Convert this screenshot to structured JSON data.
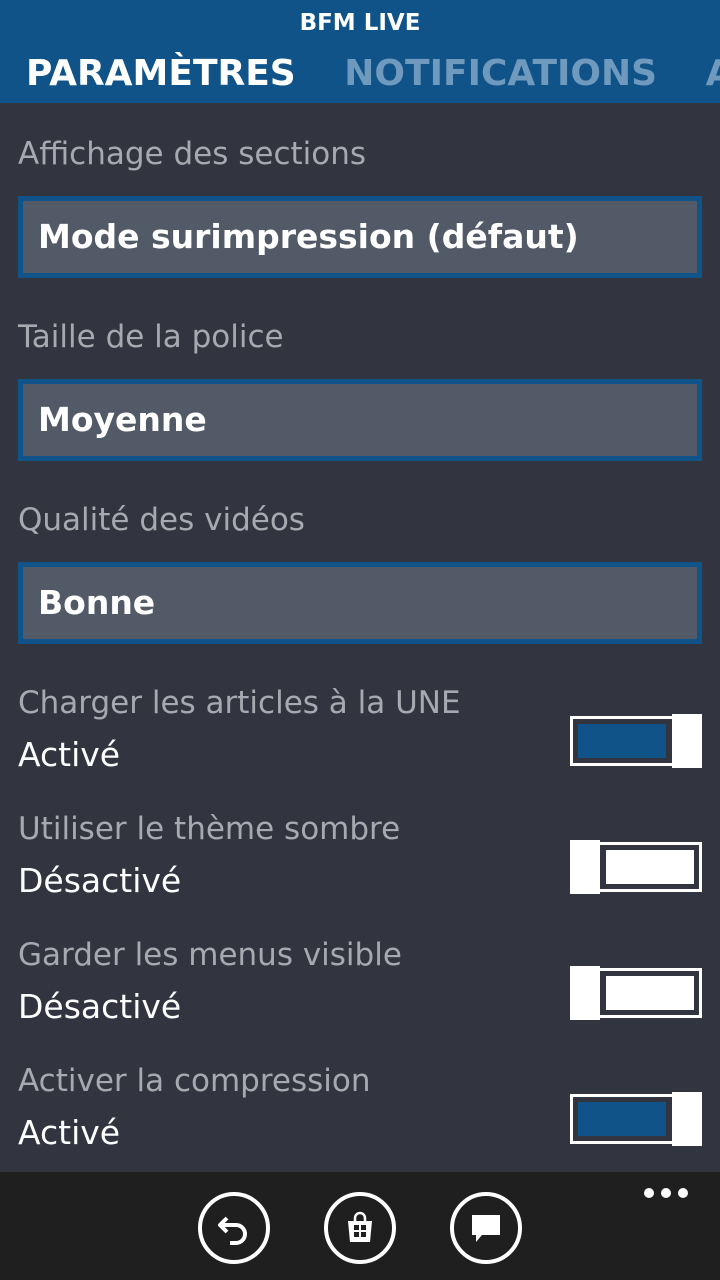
{
  "header": {
    "app_title": "BFM LIVE",
    "pivots": [
      "PARAMÈTRES",
      "NOTIFICATIONS",
      "A PROPOS"
    ]
  },
  "sections": {
    "label": "Affichage des sections",
    "value": "Mode surimpression (défaut)"
  },
  "font_size": {
    "label": "Taille de la police",
    "value": "Moyenne"
  },
  "video_quality": {
    "label": "Qualité des vidéos",
    "value": "Bonne"
  },
  "toggles": [
    {
      "title": "Charger les articles à la UNE",
      "state": "Activé",
      "on": true
    },
    {
      "title": "Utiliser le thème sombre",
      "state": "Désactivé",
      "on": false
    },
    {
      "title": "Garder les menus visible",
      "state": "Désactivé",
      "on": false
    },
    {
      "title": "Activer la compression",
      "state": "Activé",
      "on": true
    }
  ],
  "appbar": {
    "buttons": [
      "back-icon",
      "store-icon",
      "comment-icon"
    ],
    "more": "ellipsis-icon"
  },
  "colors": {
    "accent": "#0f5389",
    "background": "#32353f",
    "picker_bg": "#535a67",
    "appbar_bg": "#1f1f1f"
  }
}
